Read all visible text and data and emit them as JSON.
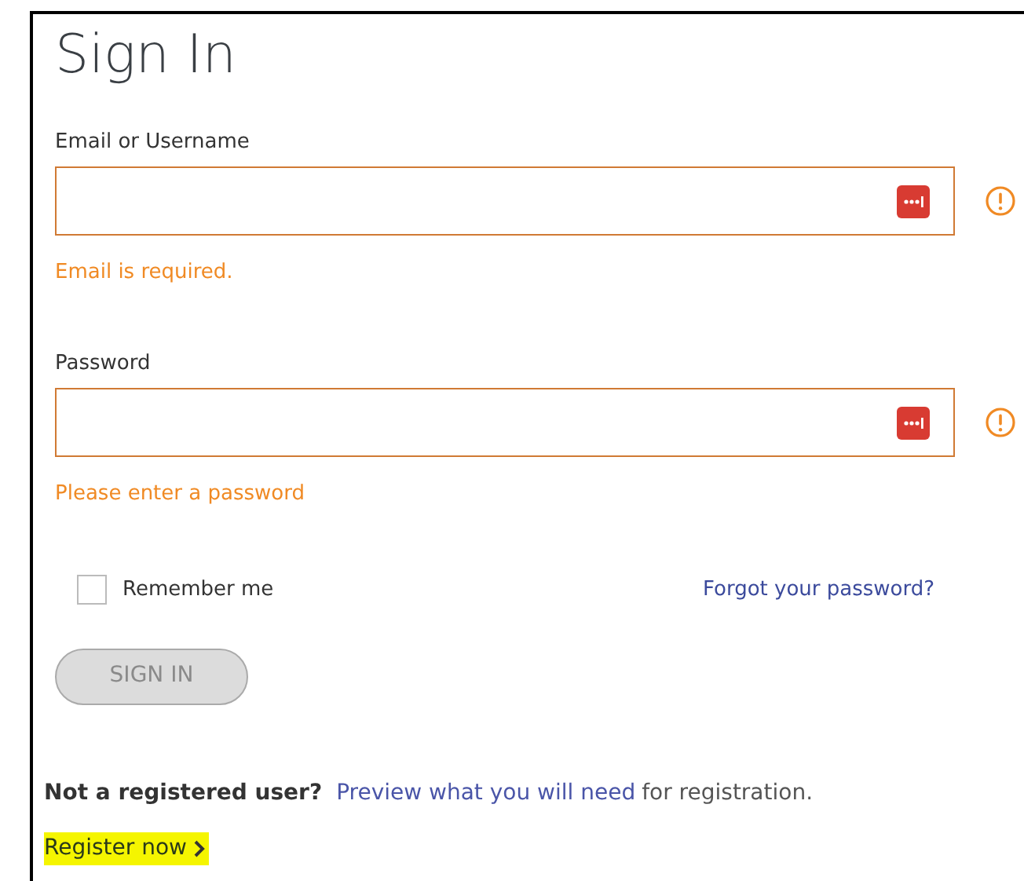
{
  "title": "Sign In",
  "fields": [
    {
      "label": "Email or Username",
      "error": "Email is required.",
      "invalid": true
    },
    {
      "label": "Password",
      "error": "Please enter a password",
      "invalid": true
    }
  ],
  "remember": {
    "label": "Remember me",
    "checked": false
  },
  "forgot_link": "Forgot your password?",
  "sign_in_button": {
    "label": "SIGN IN",
    "disabled": true
  },
  "register": {
    "question": "Not a registered user?",
    "preview_link": "Preview what you will need",
    "preview_rest": "for registration.",
    "register_link": "Register now",
    "highlighted": true
  }
}
